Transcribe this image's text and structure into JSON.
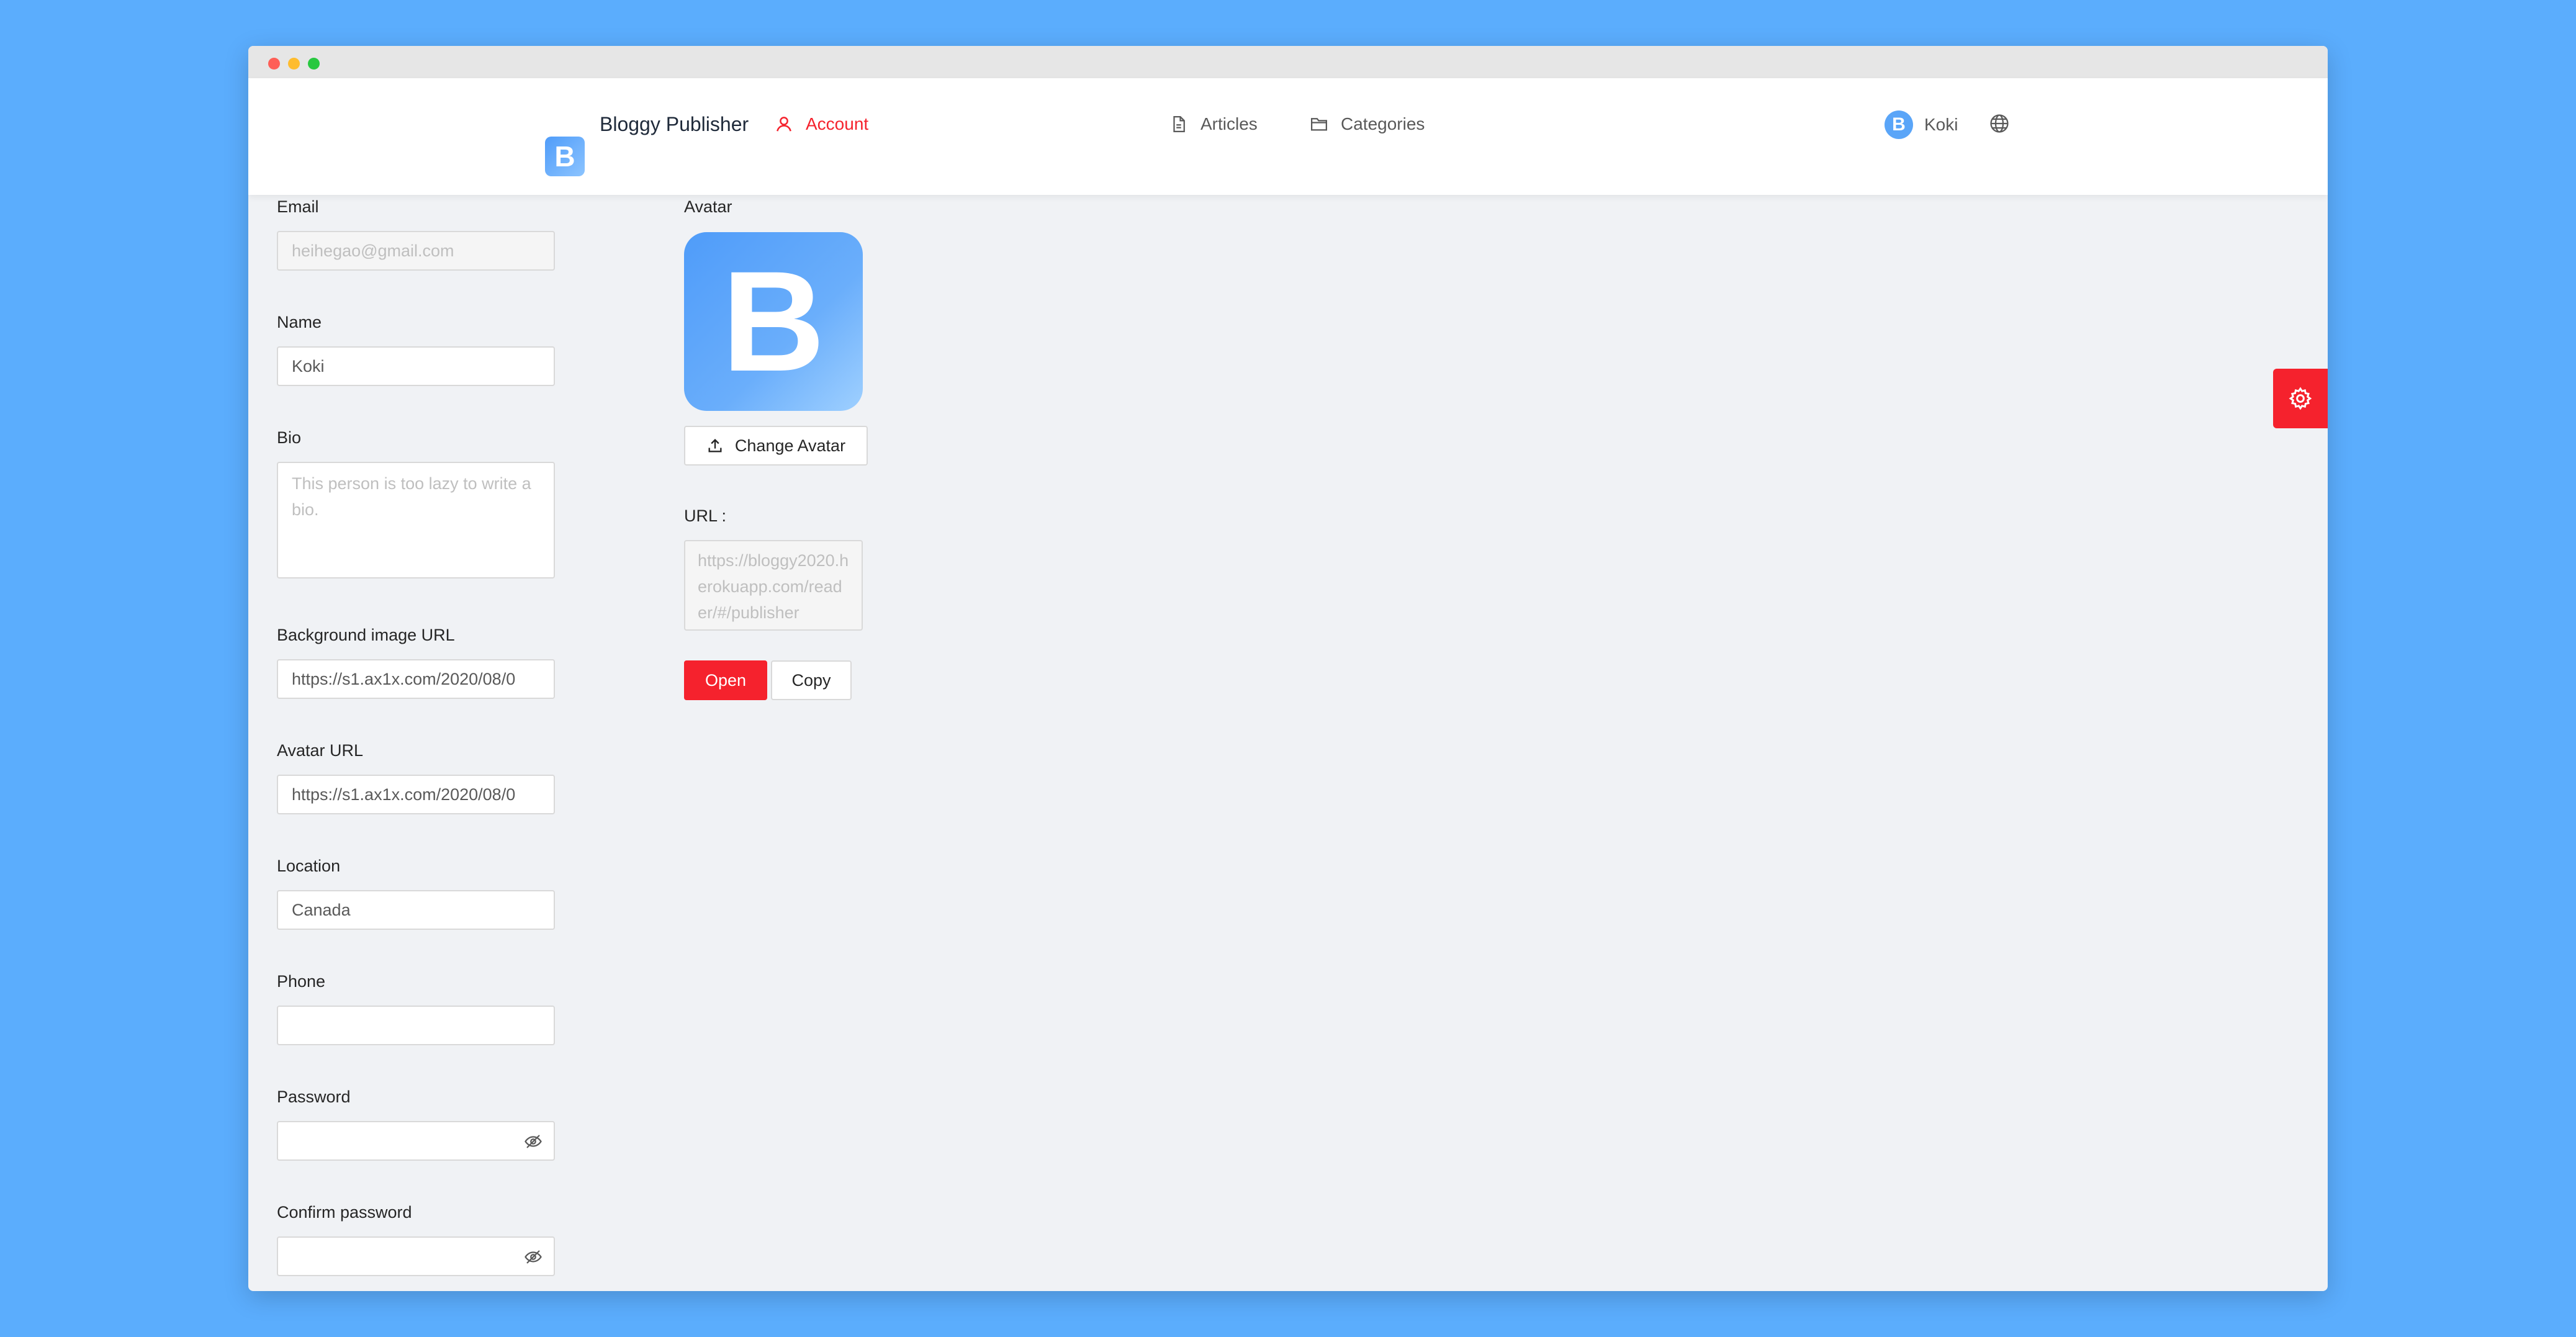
{
  "header": {
    "logo_letter": "B",
    "brand": "Bloggy Publisher",
    "nav": [
      {
        "label": "Account",
        "icon": "user-icon",
        "active": true
      },
      {
        "label": "Articles",
        "icon": "file-icon",
        "active": false
      },
      {
        "label": "Categories",
        "icon": "folder-icon",
        "active": false
      }
    ],
    "user": {
      "avatar_letter": "B",
      "name": "Koki"
    },
    "language_icon": "globe-icon"
  },
  "form": {
    "email": {
      "label": "Email",
      "value": "heihegao@gmail.com",
      "disabled": true
    },
    "name": {
      "label": "Name",
      "value": "Koki"
    },
    "bio": {
      "label": "Bio",
      "placeholder": "This person is too lazy to write a bio."
    },
    "background_image_url": {
      "label": "Background image URL",
      "value": "https://s1.ax1x.com/2020/08/0"
    },
    "avatar_url": {
      "label": "Avatar URL",
      "value": "https://s1.ax1x.com/2020/08/0"
    },
    "location": {
      "label": "Location",
      "value": "Canada"
    },
    "phone": {
      "label": "Phone",
      "value": ""
    },
    "password": {
      "label": "Password",
      "value": ""
    },
    "confirm_password": {
      "label": "Confirm password",
      "value": ""
    }
  },
  "avatar_panel": {
    "label": "Avatar",
    "avatar_letter": "B",
    "change_button": "Change Avatar",
    "url_label": "URL :",
    "url_value": "https://bloggy2020.herokuapp.com/reader/#/publisher",
    "open_button": "Open",
    "copy_button": "Copy"
  },
  "colors": {
    "accent": "#f5222d",
    "brand_blue": "#5aa5f8",
    "background": "#5badfd"
  },
  "settings_icon": "gear-icon"
}
